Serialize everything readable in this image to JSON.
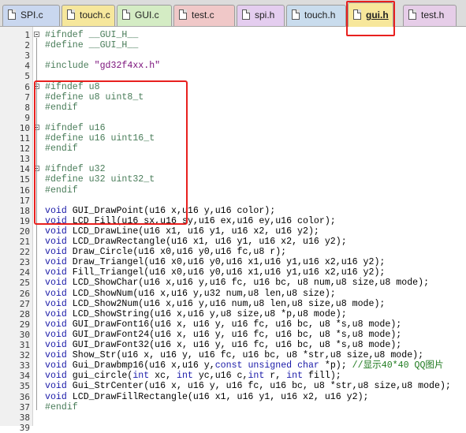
{
  "tabs": [
    {
      "label": "SPI.c",
      "color": "#c9d7ef",
      "active": false
    },
    {
      "label": "touch.c",
      "color": "#f6e79c",
      "active": false
    },
    {
      "label": "GUI.c",
      "color": "#d4ecc4",
      "active": false
    },
    {
      "label": "test.c",
      "color": "#f0c8c8",
      "active": false
    },
    {
      "label": "spi.h",
      "color": "#e4cdef",
      "active": false
    },
    {
      "label": "touch.h",
      "color": "#c9dced",
      "active": false
    },
    {
      "label": "gui.h",
      "color": "#f7e79b",
      "active": true
    },
    {
      "label": "test.h",
      "color": "#e6cde8",
      "active": false
    }
  ],
  "editor": {
    "lines": [
      {
        "n": "1",
        "fold": true,
        "seg": [
          [
            "#ifndef __GUI_H__",
            "pp"
          ]
        ]
      },
      {
        "n": "2",
        "fold": false,
        "seg": [
          [
            "#define __GUI_H__",
            "pp"
          ]
        ]
      },
      {
        "n": "3",
        "fold": false,
        "seg": []
      },
      {
        "n": "4",
        "fold": false,
        "seg": [
          [
            "#include ",
            "pp"
          ],
          [
            "\"gd32f4xx.h\"",
            "str"
          ]
        ]
      },
      {
        "n": "5",
        "fold": false,
        "seg": []
      },
      {
        "n": "6",
        "fold": true,
        "seg": [
          [
            "#ifndef u8",
            "pp"
          ]
        ]
      },
      {
        "n": "7",
        "fold": false,
        "seg": [
          [
            "#define u8 uint8_t",
            "pp"
          ]
        ]
      },
      {
        "n": "8",
        "fold": false,
        "seg": [
          [
            "#endif",
            "pp"
          ]
        ]
      },
      {
        "n": "9",
        "fold": false,
        "seg": []
      },
      {
        "n": "10",
        "fold": true,
        "seg": [
          [
            "#ifndef u16",
            "pp"
          ]
        ]
      },
      {
        "n": "11",
        "fold": false,
        "seg": [
          [
            "#define u16 uint16_t",
            "pp"
          ]
        ]
      },
      {
        "n": "12",
        "fold": false,
        "seg": [
          [
            "#endif",
            "pp"
          ]
        ]
      },
      {
        "n": "13",
        "fold": false,
        "seg": []
      },
      {
        "n": "14",
        "fold": true,
        "seg": [
          [
            "#ifndef u32",
            "pp"
          ]
        ]
      },
      {
        "n": "15",
        "fold": false,
        "seg": [
          [
            "#define u32 uint32_t",
            "pp"
          ]
        ]
      },
      {
        "n": "16",
        "fold": false,
        "seg": [
          [
            "#endif",
            "pp"
          ]
        ]
      },
      {
        "n": "17",
        "fold": false,
        "seg": []
      },
      {
        "n": "18",
        "fold": false,
        "seg": [
          [
            "void",
            "kw"
          ],
          [
            " GUI_DrawPoint(u16 x,u16 y,u16 color);",
            ""
          ]
        ]
      },
      {
        "n": "19",
        "fold": false,
        "seg": [
          [
            "void",
            "kw"
          ],
          [
            " LCD_Fill(u16 sx,u16 sy,u16 ex,u16 ey,u16 color);",
            ""
          ]
        ]
      },
      {
        "n": "20",
        "fold": false,
        "seg": [
          [
            "void",
            "kw"
          ],
          [
            " LCD_DrawLine(u16 x1, u16 y1, u16 x2, u16 y2);",
            ""
          ]
        ]
      },
      {
        "n": "21",
        "fold": false,
        "seg": [
          [
            "void",
            "kw"
          ],
          [
            " LCD_DrawRectangle(u16 x1, u16 y1, u16 x2, u16 y2);",
            ""
          ]
        ]
      },
      {
        "n": "22",
        "fold": false,
        "seg": [
          [
            "void",
            "kw"
          ],
          [
            " Draw_Circle(u16 x0,u16 y0,u16 fc,u8 r);",
            ""
          ]
        ]
      },
      {
        "n": "23",
        "fold": false,
        "seg": [
          [
            "void",
            "kw"
          ],
          [
            " Draw_Triangel(u16 x0,u16 y0,u16 x1,u16 y1,u16 x2,u16 y2);",
            ""
          ]
        ]
      },
      {
        "n": "24",
        "fold": false,
        "seg": [
          [
            "void",
            "kw"
          ],
          [
            " Fill_Triangel(u16 x0,u16 y0,u16 x1,u16 y1,u16 x2,u16 y2);",
            ""
          ]
        ]
      },
      {
        "n": "25",
        "fold": false,
        "seg": [
          [
            "void",
            "kw"
          ],
          [
            " LCD_ShowChar(u16 x,u16 y,u16 fc, u16 bc, u8 num,u8 size,u8 mode);",
            ""
          ]
        ]
      },
      {
        "n": "26",
        "fold": false,
        "seg": [
          [
            "void",
            "kw"
          ],
          [
            " LCD_ShowNum(u16 x,u16 y,u32 num,u8 len,u8 size);",
            ""
          ]
        ]
      },
      {
        "n": "27",
        "fold": false,
        "seg": [
          [
            "void",
            "kw"
          ],
          [
            " LCD_Show2Num(u16 x,u16 y,u16 num,u8 len,u8 size,u8 mode);",
            ""
          ]
        ]
      },
      {
        "n": "28",
        "fold": false,
        "seg": [
          [
            "void",
            "kw"
          ],
          [
            " LCD_ShowString(u16 x,u16 y,u8 size,u8 *p,u8 mode);",
            ""
          ]
        ]
      },
      {
        "n": "29",
        "fold": false,
        "seg": [
          [
            "void",
            "kw"
          ],
          [
            " GUI_DrawFont16(u16 x, u16 y, u16 fc, u16 bc, u8 *s,u8 mode);",
            ""
          ]
        ]
      },
      {
        "n": "30",
        "fold": false,
        "seg": [
          [
            "void",
            "kw"
          ],
          [
            " GUI_DrawFont24(u16 x, u16 y, u16 fc, u16 bc, u8 *s,u8 mode);",
            ""
          ]
        ]
      },
      {
        "n": "31",
        "fold": false,
        "seg": [
          [
            "void",
            "kw"
          ],
          [
            " GUI_DrawFont32(u16 x, u16 y, u16 fc, u16 bc, u8 *s,u8 mode);",
            ""
          ]
        ]
      },
      {
        "n": "32",
        "fold": false,
        "seg": [
          [
            "void",
            "kw"
          ],
          [
            " Show_Str(u16 x, u16 y, u16 fc, u16 bc, u8 *str,u8 size,u8 mode);",
            ""
          ]
        ]
      },
      {
        "n": "33",
        "fold": false,
        "seg": [
          [
            "void",
            "kw"
          ],
          [
            " Gui_Drawbmp16(u16 x,u16 y,",
            ""
          ],
          [
            "const unsigned char",
            "kw"
          ],
          [
            " *p); ",
            ""
          ],
          [
            "//显示40*40 QQ图片",
            "cm"
          ]
        ]
      },
      {
        "n": "34",
        "fold": false,
        "seg": [
          [
            "void",
            "kw"
          ],
          [
            " gui_circle(",
            ""
          ],
          [
            "int",
            "kw"
          ],
          [
            " xc, ",
            ""
          ],
          [
            "int",
            "kw"
          ],
          [
            " yc,u16 c,",
            ""
          ],
          [
            "int",
            "kw"
          ],
          [
            " r, ",
            ""
          ],
          [
            "int",
            "kw"
          ],
          [
            " fill);",
            ""
          ]
        ]
      },
      {
        "n": "35",
        "fold": false,
        "seg": [
          [
            "void",
            "kw"
          ],
          [
            " Gui_StrCenter(u16 x, u16 y, u16 fc, u16 bc, u8 *str,u8 size,u8 mode);",
            ""
          ]
        ]
      },
      {
        "n": "36",
        "fold": false,
        "seg": [
          [
            "void",
            "kw"
          ],
          [
            " LCD_DrawFillRectangle(u16 x1, u16 y1, u16 x2, u16 y2);",
            ""
          ]
        ]
      },
      {
        "n": "37",
        "fold": false,
        "seg": [
          [
            "#endif",
            "pp"
          ]
        ]
      },
      {
        "n": "38",
        "fold": false,
        "seg": []
      },
      {
        "n": "39",
        "fold": false,
        "seg": []
      }
    ]
  },
  "colors": {
    "highlight": "#e8201e",
    "preprocessor": "#4a7d5a",
    "string": "#7a0f7a",
    "keyword": "#1a1aa8",
    "comment": "#1f7a1f"
  }
}
